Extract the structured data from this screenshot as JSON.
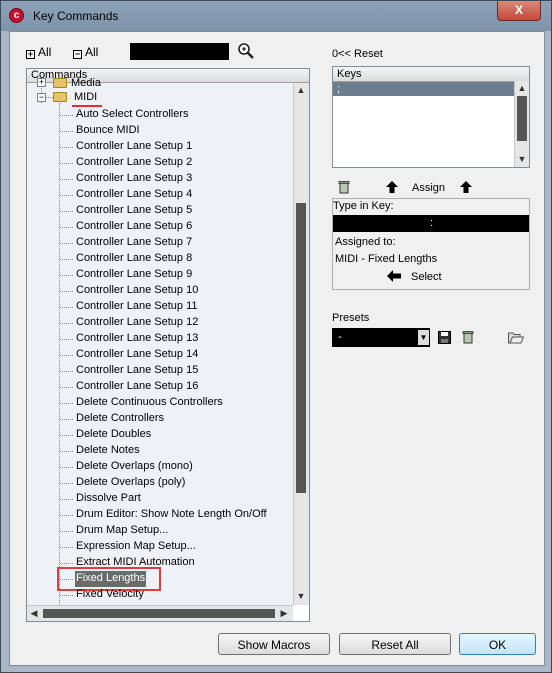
{
  "window": {
    "title": "Key Commands",
    "close_label": "X"
  },
  "toolbar": {
    "expand_all_label": "All",
    "collapse_all_label": "All",
    "search_value": ""
  },
  "commands": {
    "header": "Commands",
    "parent_folder": "Media",
    "folder": "MIDI",
    "items": [
      "Auto Select Controllers",
      "Bounce MIDI",
      "Controller Lane Setup 1",
      "Controller Lane Setup 2",
      "Controller Lane Setup 3",
      "Controller Lane Setup 4",
      "Controller Lane Setup 5",
      "Controller Lane Setup 6",
      "Controller Lane Setup 7",
      "Controller Lane Setup 8",
      "Controller Lane Setup 9",
      "Controller Lane Setup 10",
      "Controller Lane Setup 11",
      "Controller Lane Setup 12",
      "Controller Lane Setup 13",
      "Controller Lane Setup 14",
      "Controller Lane Setup 15",
      "Controller Lane Setup 16",
      "Delete Continuous Controllers",
      "Delete Controllers",
      "Delete Doubles",
      "Delete Notes",
      "Delete Overlaps (mono)",
      "Delete Overlaps (poly)",
      "Dissolve Part",
      "Drum Editor: Show Note Length On/Off",
      "Drum Map Setup...",
      "Expression Map Setup...",
      "Extract MIDI Automation",
      "Fixed Lengths",
      "Fixed Velocity"
    ],
    "selected_item": "Fixed Lengths"
  },
  "keys": {
    "reset_label": "Reset",
    "header": "Keys",
    "rows": [
      ";"
    ]
  },
  "assign": {
    "assign_label": "Assign",
    "type_in_key_label": "Type in Key:",
    "type_in_key_value": ":",
    "assigned_to_label": "Assigned to:",
    "assigned_to_value": "MIDI - Fixed Lengths",
    "select_label": "Select"
  },
  "presets": {
    "label": "Presets",
    "selected": "-"
  },
  "footer": {
    "show_macros": "Show Macros",
    "reset_all": "Reset All",
    "ok": "OK"
  }
}
